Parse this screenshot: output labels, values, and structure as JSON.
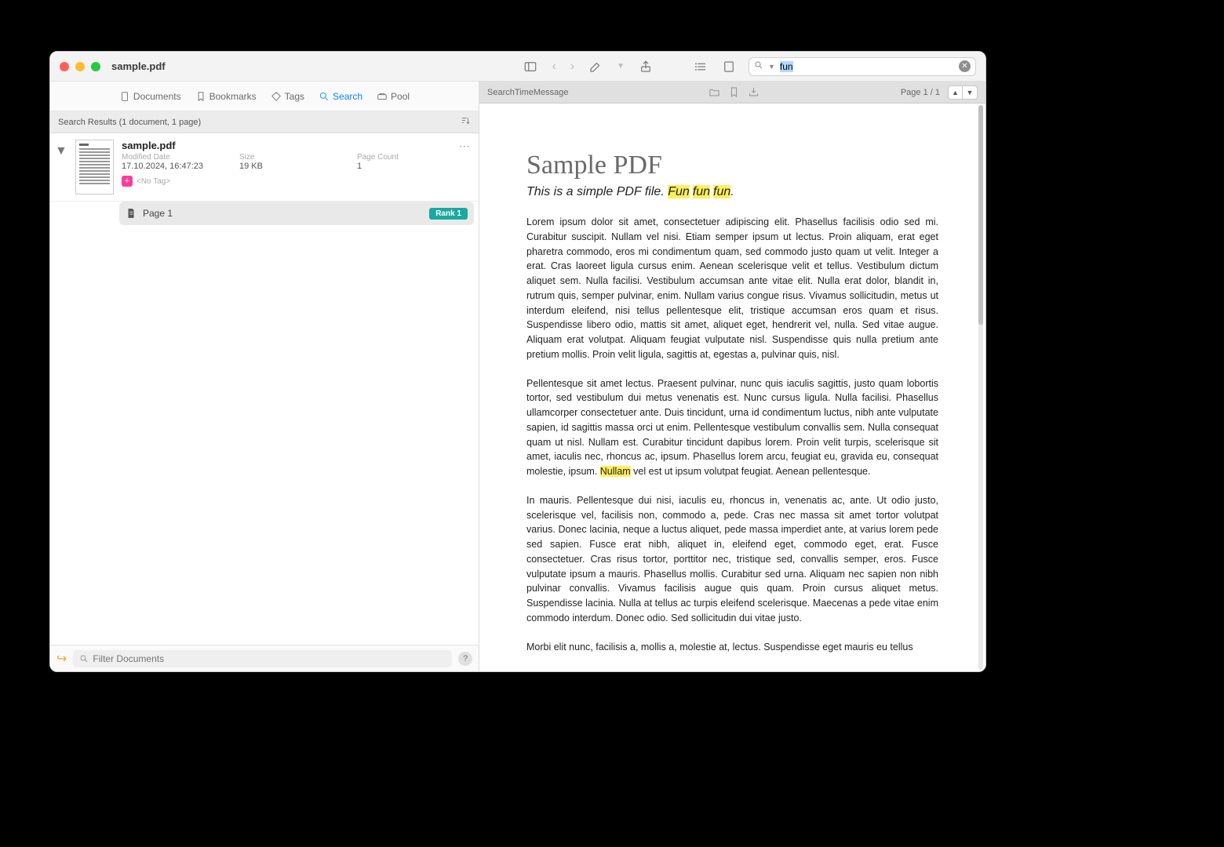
{
  "window": {
    "title": "sample.pdf"
  },
  "toolbar": {
    "search_value": "fun"
  },
  "tabs": {
    "documents": "Documents",
    "bookmarks": "Bookmarks",
    "tags": "Tags",
    "search": "Search",
    "pool": "Pool"
  },
  "results": {
    "header": "Search Results (1 document, 1 page)",
    "item": {
      "name": "sample.pdf",
      "modified_label": "Modified Date",
      "modified_value": "17.10.2024, 16:47:23",
      "size_label": "Size",
      "size_value": "19 KB",
      "pagecount_label": "Page Count",
      "pagecount_value": "1",
      "notag": "<No Tag>"
    },
    "page_row": "Page 1",
    "rank": "Rank 1"
  },
  "leftfoot": {
    "filter_placeholder": "Filter Documents"
  },
  "subbar": {
    "msg": "SearchTimeMessage",
    "page": "Page 1 / 1"
  },
  "document": {
    "title": "Sample PDF",
    "subtitle_prefix": "This is a simple PDF file. ",
    "hl1": "Fun",
    "hl2": "fun",
    "hl3": "fun",
    "subtitle_suffix": ".",
    "para1": "Lorem ipsum dolor sit amet, consectetuer adipiscing elit. Phasellus facilisis odio sed mi. Curabitur suscipit. Nullam vel nisi. Etiam semper ipsum ut lectus. Proin aliquam, erat eget pharetra commodo, eros mi condimentum quam, sed commodo justo quam ut velit. Integer a erat. Cras laoreet ligula cursus enim. Aenean scelerisque velit et tellus. Vestibulum dictum aliquet sem. Nulla facilisi. Vestibulum accumsan ante vitae elit. Nulla erat dolor, blandit in, rutrum quis, semper pulvinar, enim. Nullam varius congue risus. Vivamus sollicitudin, metus ut interdum eleifend, nisi tellus pellentesque elit, tristique accumsan eros quam et risus. Suspendisse libero odio, mattis sit amet, aliquet eget, hendrerit vel, nulla. Sed vitae augue. Aliquam erat volutpat. Aliquam feugiat vulputate nisl. Suspendisse quis nulla pretium ante pretium mollis. Proin velit ligula, sagittis at, egestas a, pulvinar quis, nisl.",
    "para2_a": "Pellentesque sit amet lectus. Praesent pulvinar, nunc quis iaculis sagittis, justo quam lobortis tortor, sed vestibulum dui metus venenatis est. Nunc cursus ligula. Nulla facilisi. Phasellus ullamcorper consectetuer ante. Duis tincidunt, urna id condimentum luctus, nibh ante vulputate sapien, id sagittis massa orci ut enim. Pellentesque vestibulum convallis sem. Nulla consequat quam ut nisl. Nullam est. Curabitur tincidunt dapibus lorem. Proin velit turpis, scelerisque sit amet, iaculis nec, rhoncus ac, ipsum. Phasellus lorem arcu, feugiat eu, gravida eu, consequat molestie, ipsum. ",
    "para2_hl": "Nullam",
    "para2_b": " vel est ut ipsum volutpat feugiat. Aenean pellentesque.",
    "para3": "In mauris. Pellentesque dui nisi, iaculis eu, rhoncus in, venenatis ac, ante. Ut odio justo, scelerisque vel, facilisis non, commodo a, pede. Cras nec massa sit amet tortor volutpat varius. Donec lacinia, neque a luctus aliquet, pede massa imperdiet ante, at varius lorem pede sed sapien. Fusce erat nibh, aliquet in, eleifend eget, commodo eget, erat. Fusce consectetuer. Cras risus tortor, porttitor nec, tristique sed, convallis semper, eros. Fusce vulputate ipsum a mauris. Phasellus mollis. Curabitur sed urna. Aliquam nec sapien non nibh pulvinar convallis. Vivamus facilisis augue quis quam. Proin cursus aliquet metus. Suspendisse lacinia. Nulla at tellus ac turpis eleifend scelerisque. Maecenas a pede vitae enim commodo interdum. Donec odio. Sed sollicitudin dui vitae justo.",
    "para4": "Morbi elit nunc, facilisis a, mollis a, molestie at, lectus. Suspendisse eget mauris eu tellus"
  }
}
